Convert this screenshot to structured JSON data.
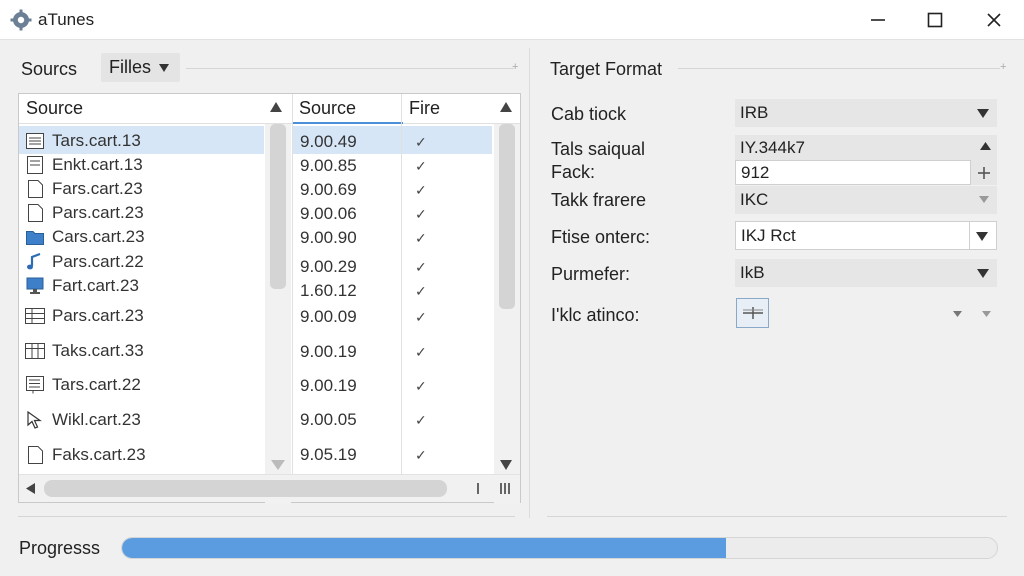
{
  "window": {
    "title": "aTunes"
  },
  "left": {
    "sources_label": "Sourcs",
    "files_dropdown": "Filles",
    "columns": {
      "name": "Source",
      "value": "Source",
      "flag": "Fire"
    },
    "rows": [
      {
        "name": "Tars.cart.13",
        "value": "9.00.49",
        "flag": "✓",
        "icon": "list-icon"
      },
      {
        "name": "Enkt.cart.13",
        "value": "9.00.85",
        "flag": "✓",
        "icon": "document-lines-icon"
      },
      {
        "name": "Fars.cart.23",
        "value": "9.00.69",
        "flag": "✓",
        "icon": "file-icon"
      },
      {
        "name": "Pars.cart.23",
        "value": "9.00.06",
        "flag": "✓",
        "icon": "file-icon"
      },
      {
        "name": "Cars.cart.23",
        "value": "9.00.90",
        "flag": "✓",
        "icon": "folder-icon"
      },
      {
        "name": "Pars.cart.22",
        "value": "9.00.29",
        "flag": "✓",
        "icon": "music-note-icon"
      },
      {
        "name": "Fart.cart.23",
        "value": "1.60.12",
        "flag": "✓",
        "icon": "monitor-icon"
      },
      {
        "name": "Pars.cart.23",
        "value": "9.00.09",
        "flag": "✓",
        "icon": "table-icon"
      },
      {
        "name": "Taks.cart.33",
        "value": "9.00.19",
        "flag": "✓",
        "icon": "table-icon"
      },
      {
        "name": "Tars.cart.22",
        "value": "9.00.19",
        "flag": "✓",
        "icon": "list-box-icon"
      },
      {
        "name": "Wikl.cart.23",
        "value": "9.00.05",
        "flag": "✓",
        "icon": "cursor-icon"
      },
      {
        "name": "Faks.cart.23",
        "value": "9.05.19",
        "flag": "✓",
        "icon": "file-icon"
      }
    ]
  },
  "right": {
    "target_label": "Target Format",
    "props": [
      {
        "label": "Cab tiock",
        "value": "IRB"
      },
      {
        "label": "Tals saiqual",
        "value": "IY.344k7"
      },
      {
        "label": "Fack:",
        "value": "912"
      },
      {
        "label": "Takk frarere",
        "value": "IKC"
      },
      {
        "label": "Ftise onterc:",
        "value": "IKJ Rct"
      },
      {
        "label": "Purmefer:",
        "value": "IkB"
      },
      {
        "label": "I'klc atinco:",
        "value": ""
      }
    ]
  },
  "progress": {
    "label": "Progresss",
    "percent": 69
  },
  "colors": {
    "accent": "#5b9be0",
    "selection": "#d6e6f7"
  }
}
